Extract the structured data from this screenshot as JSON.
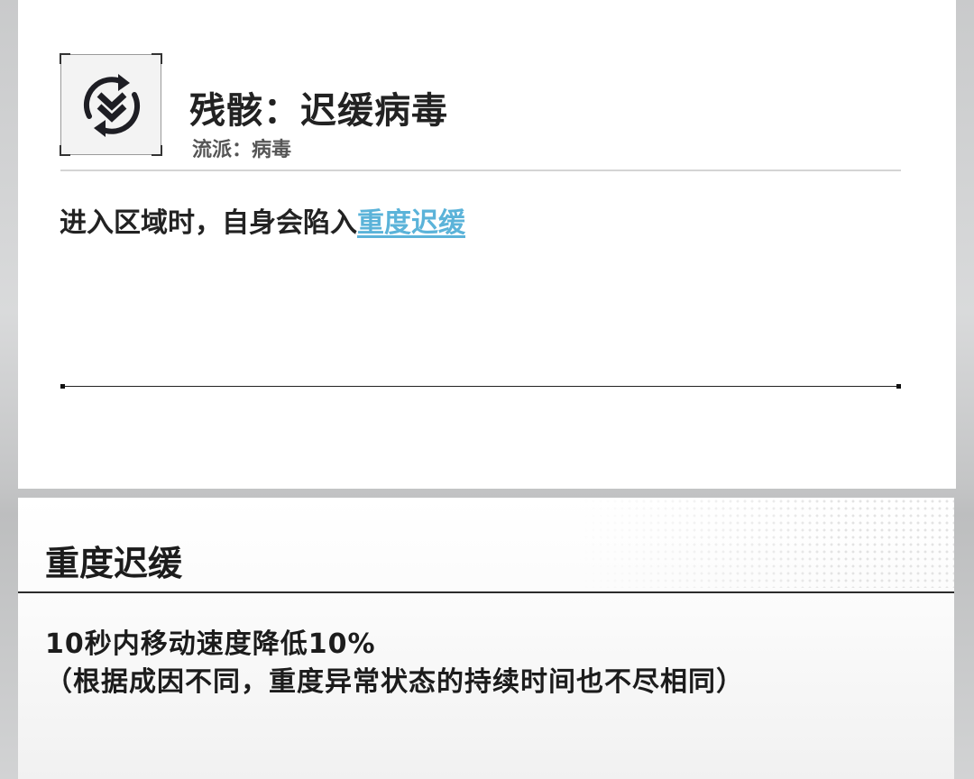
{
  "skill": {
    "icon": "double-chevron-down-cycle-icon",
    "title": "残骸：迟缓病毒",
    "subtitle": "流派：病毒",
    "description_prefix": "进入区域时，自身会陷入",
    "description_keyword": "重度迟缓"
  },
  "tooltip": {
    "title": "重度迟缓",
    "line1": "10秒内移动速度降低10%",
    "line2": "（根据成因不同，重度异常状态的持续时间也不尽相同）"
  },
  "colors": {
    "keyword": "#5bb3d9",
    "text": "#222222",
    "panel": "#ffffff"
  }
}
